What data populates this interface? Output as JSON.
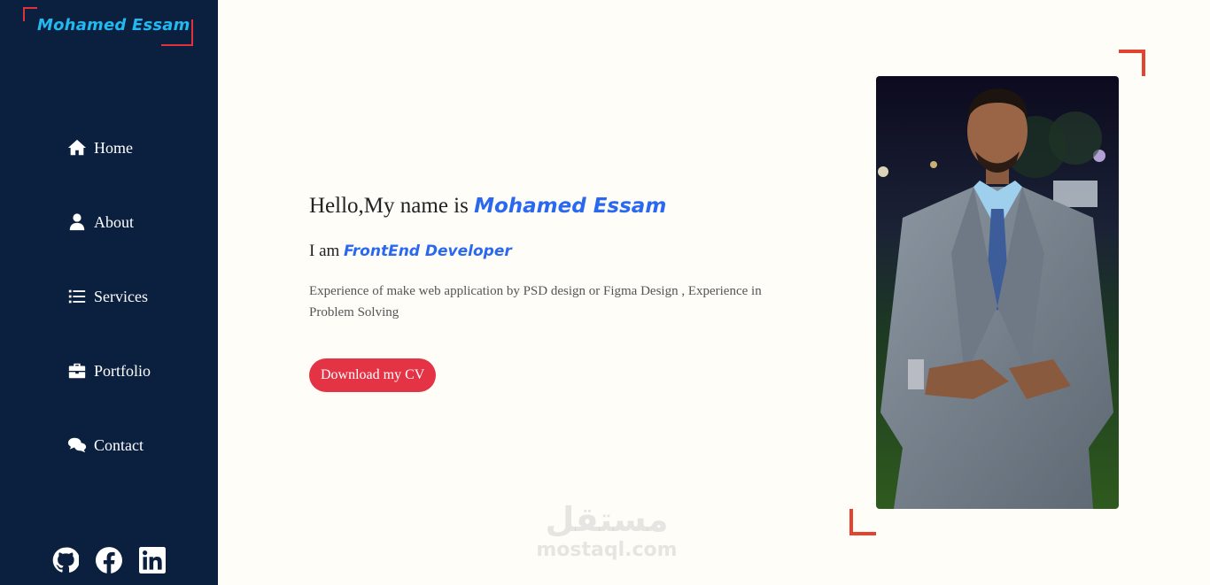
{
  "sidebar": {
    "logo": "Mohamed Essam",
    "nav": [
      {
        "label": "Home",
        "icon": "home-icon"
      },
      {
        "label": "About",
        "icon": "user-icon"
      },
      {
        "label": "Services",
        "icon": "list-icon"
      },
      {
        "label": "Portfolio",
        "icon": "briefcase-icon"
      },
      {
        "label": "Contact",
        "icon": "comments-icon"
      }
    ],
    "social": [
      {
        "icon": "github-icon"
      },
      {
        "icon": "facebook-icon"
      },
      {
        "icon": "linkedin-icon"
      }
    ]
  },
  "hero": {
    "greeting_prefix": "Hello,My name is ",
    "name": "Mohamed Essam",
    "role_prefix": "I am ",
    "role": "FrontEnd Developer",
    "description": "Experience of make web application by PSD design or Figma Design , Experience in Problem Solving",
    "cv_button": "Download my CV"
  },
  "watermark": {
    "arabic": "مستقل",
    "latin": "mostaql.com"
  },
  "colors": {
    "sidebar_bg": "#0b1f3f",
    "page_bg": "#fffdf8",
    "accent_blue": "#2a68f0",
    "logo_cyan": "#22b8f0",
    "button_red": "#e33345",
    "frame_orange": "#e4442f"
  }
}
